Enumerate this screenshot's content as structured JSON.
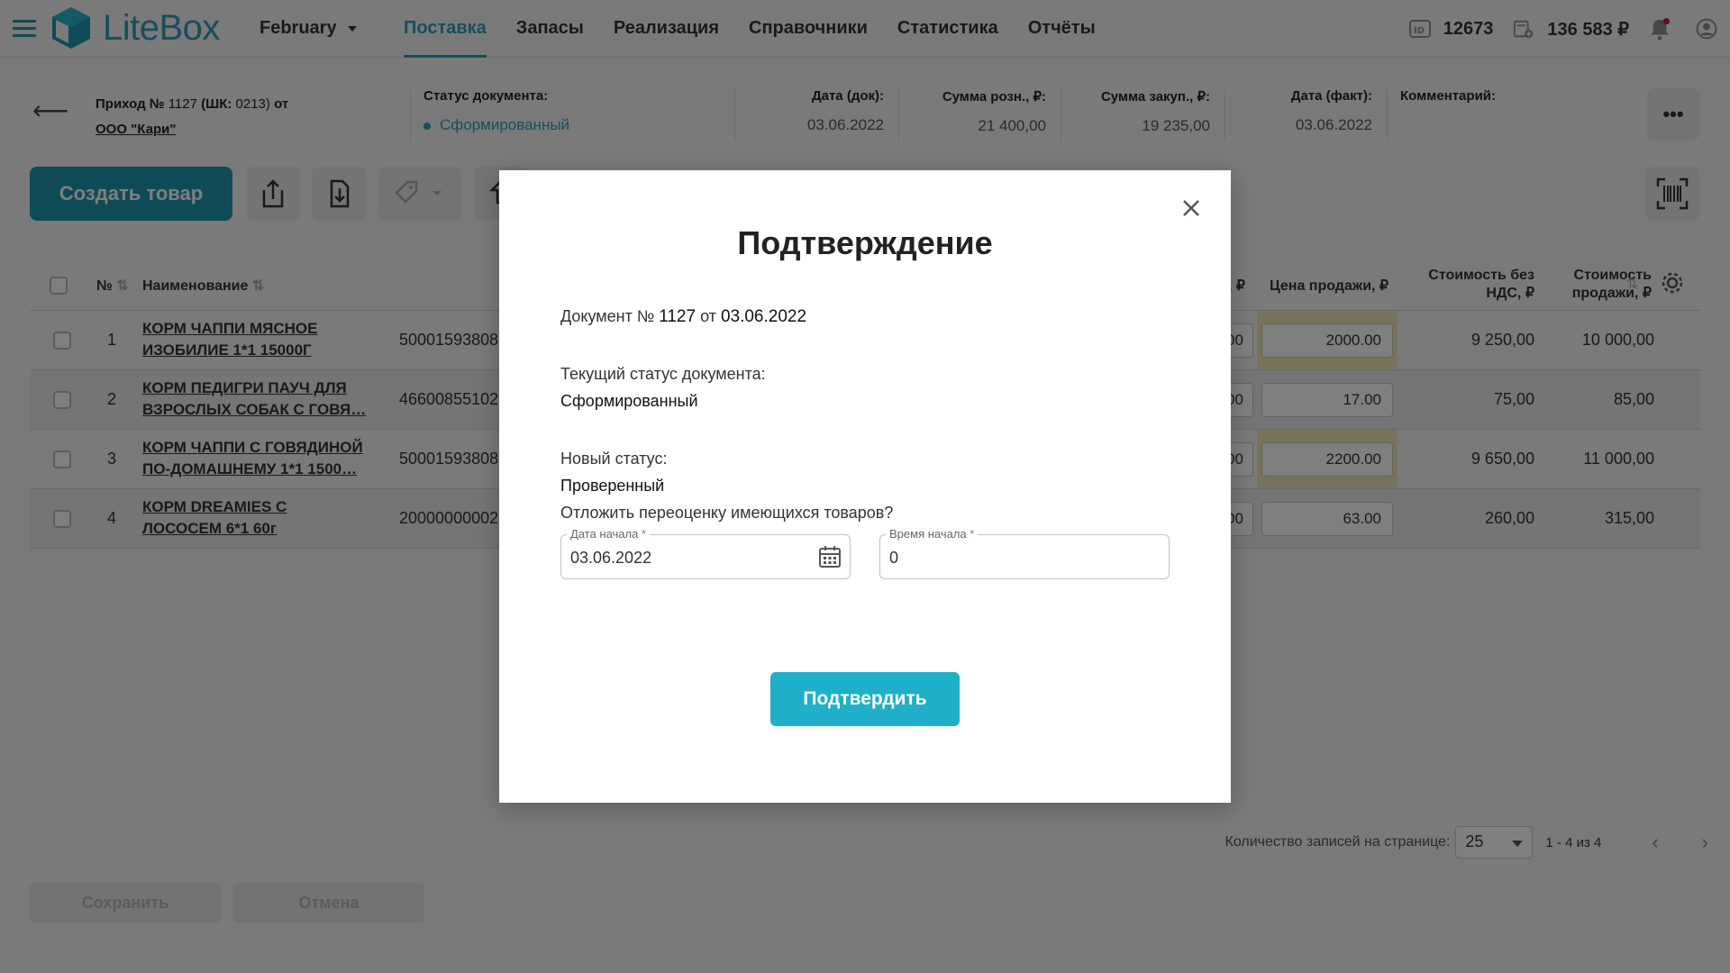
{
  "app": {
    "logo_text": "LiteBox",
    "month": "February",
    "accent": "#2a9fb8"
  },
  "nav": {
    "items": [
      {
        "label": "Поставка",
        "active": true
      },
      {
        "label": "Запасы"
      },
      {
        "label": "Реализация"
      },
      {
        "label": "Справочники"
      },
      {
        "label": "Статистика"
      },
      {
        "label": "Отчёты"
      }
    ]
  },
  "top_right": {
    "id_value": "12673",
    "balance": "136 583 ₽"
  },
  "doc_header": {
    "title_part1": "Приход №",
    "title_number": "1127",
    "title_part2": "(ШК:",
    "title_code": "0213)",
    "title_part3": "от",
    "supplier": "ООО \"Кари\"",
    "status_label": "Статус документа:",
    "status_value": "Сформированный",
    "date_doc_label": "Дата (док):",
    "date_doc_value": "03.06.2022",
    "sum_retail_label": "Сумма розн., ₽:",
    "sum_retail_value": "21 400,00",
    "sum_purchase_label": "Сумма закуп., ₽:",
    "sum_purchase_value": "19 235,00",
    "date_fact_label": "Дата (факт):",
    "date_fact_value": "03.06.2022",
    "comment_label": "Комментарий:",
    "more_label": "•••"
  },
  "toolbar": {
    "create_label": "Создать товар"
  },
  "table": {
    "headers": {
      "num": "№",
      "name": "Наименование",
      "prev_partial": ", ₽",
      "sale_price": "Цена продажи, ₽",
      "cost_no_vat_1": "Стоимость без",
      "cost_no_vat_2": "НДС, ₽",
      "sale_cost_1": "Стоимость",
      "sale_cost_2": "продажи, ₽"
    },
    "rows": [
      {
        "num": "1",
        "name_1": "КОРМ ЧАППИ МЯСНОЕ",
        "name_2": "ИЗОБИЛИЕ 1*1 15000Г",
        "barcode": "50001593808",
        "prev": "00",
        "price": "2000.00",
        "cost": "9 250,00",
        "sale": "10 000,00"
      },
      {
        "num": "2",
        "name_1": "КОРМ ПЕДИГРИ ПАУЧ ДЛЯ",
        "name_2": "ВЗРОСЛЫХ СОБАК С ГОВЯ…",
        "barcode": "46600855102",
        "prev": "00",
        "price": "17.00",
        "cost": "75,00",
        "sale": "85,00"
      },
      {
        "num": "3",
        "name_1": "КОРМ ЧАППИ С ГОВЯДИНОЙ",
        "name_2": "ПО-ДОМАШНЕМУ 1*1 1500…",
        "barcode": "50001593808",
        "prev": "00",
        "price": "2200.00",
        "cost": "9 650,00",
        "sale": "11 000,00"
      },
      {
        "num": "4",
        "name_1": "КОРМ DREAMIES С",
        "name_2": "ЛОСОСЕМ 6*1 60г",
        "barcode": "20000000002",
        "prev": "00",
        "price": "63.00",
        "cost": "260,00",
        "sale": "315,00"
      }
    ]
  },
  "pager": {
    "label": "Количество записей на странице:",
    "per_page": "25",
    "range": "1 - 4 из 4"
  },
  "bottom": {
    "save_label": "Сохранить",
    "cancel_label": "Отмена"
  },
  "modal": {
    "title": "Подтверждение",
    "doc_prefix": "Документ №",
    "doc_number": "1127",
    "doc_from": "от",
    "doc_date": "03.06.2022",
    "current_status_label": "Текущий статус документа:",
    "current_status_value": "Сформированный",
    "new_status_label": "Новый статус:",
    "new_status_value": "Проверенный",
    "postpone_question": "Отложить переоценку имеющихся товаров?",
    "start_date_label": "Дата начала",
    "start_date_value": "03.06.2022",
    "start_time_label": "Время начала",
    "start_time_value": "0",
    "required_mark": "*",
    "confirm_label": "Подтвердить"
  }
}
